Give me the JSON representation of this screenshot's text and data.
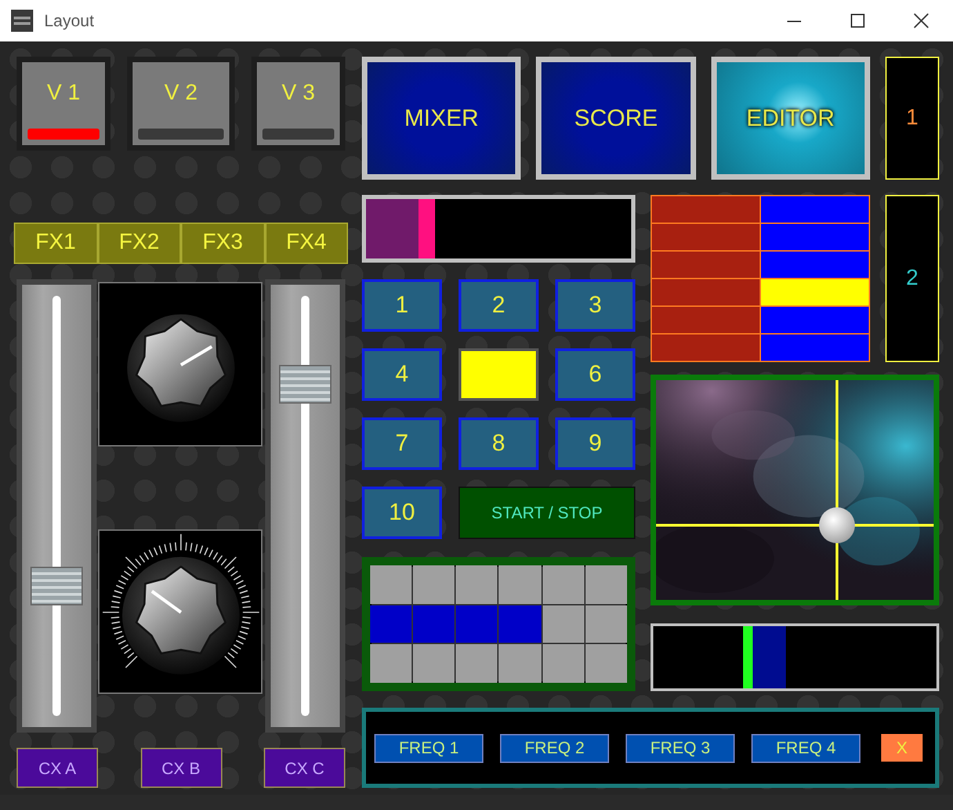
{
  "window": {
    "title": "Layout"
  },
  "voices": [
    {
      "label": "V 1",
      "on": true
    },
    {
      "label": "V 2",
      "on": false
    },
    {
      "label": "V 3",
      "on": false
    }
  ],
  "effects": [
    "FX1",
    "FX2",
    "FX3",
    "FX4"
  ],
  "sliders": [
    {
      "level": 0.31
    },
    {
      "level": 0.79
    }
  ],
  "knobs": [
    {
      "kind": "plain",
      "level": 0.72
    },
    {
      "kind": "scaled",
      "level": 0.3
    }
  ],
  "cx_buttons": [
    "CX A",
    "CX B",
    "CX C"
  ],
  "tabs": [
    {
      "label": "MIXER",
      "selected": false
    },
    {
      "label": "SCORE",
      "selected": false
    },
    {
      "label": "EDITOR",
      "selected": true
    }
  ],
  "displays": [
    {
      "value": "1",
      "color": "#ff8c3a"
    },
    {
      "value": "2",
      "color": "#33cccc"
    }
  ],
  "level_bar": {
    "level": 0.26
  },
  "color_grid": {
    "rows": [
      {
        "selected": false
      },
      {
        "selected": false
      },
      {
        "selected": false
      },
      {
        "selected": true
      },
      {
        "selected": false
      },
      {
        "selected": false
      }
    ]
  },
  "pads": [
    {
      "label": "1",
      "selected": false
    },
    {
      "label": "2",
      "selected": false
    },
    {
      "label": "3",
      "selected": false
    },
    {
      "label": "4",
      "selected": false
    },
    {
      "selected": true
    },
    {
      "label": "6",
      "selected": false
    },
    {
      "label": "7",
      "selected": false
    },
    {
      "label": "8",
      "selected": false
    },
    {
      "label": "9",
      "selected": false
    },
    {
      "label": "10",
      "selected": false
    }
  ],
  "start_stop": "START / STOP",
  "matrix": {
    "rows": [
      {
        "cells": [
          {
            "on": false
          },
          {
            "on": false
          },
          {
            "on": false
          },
          {
            "on": false
          },
          {
            "on": false
          },
          {
            "on": false
          }
        ]
      },
      {
        "cells": [
          {
            "on": true
          },
          {
            "on": true
          },
          {
            "on": true
          },
          {
            "on": true
          },
          {
            "on": false
          },
          {
            "on": false
          }
        ]
      },
      {
        "cells": [
          {
            "on": false
          },
          {
            "on": false
          },
          {
            "on": false
          },
          {
            "on": false
          },
          {
            "on": false
          },
          {
            "on": false
          }
        ]
      }
    ]
  },
  "xy_pad": {
    "x": {
      "level": 0.65
    },
    "y": {
      "level": 0.66
    }
  },
  "meter": {
    "level": 0.35
  },
  "freq_buttons": [
    "FREQ 1",
    "FREQ 2",
    "FREQ 3",
    "FREQ 4"
  ],
  "close_button": "X"
}
